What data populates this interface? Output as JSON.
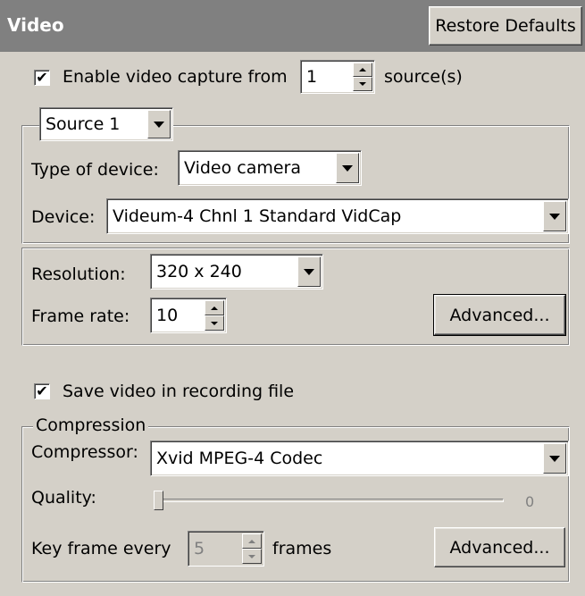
{
  "header": {
    "title": "Video",
    "restore_defaults_label": "Restore Defaults"
  },
  "capture": {
    "enabled": true,
    "check_mark": "✔",
    "label_prefix": "Enable video capture from",
    "source_count": "1",
    "label_suffix": "source(s)"
  },
  "source": {
    "selected": "Source 1",
    "type_label": "Type of device:",
    "type_value": "Video camera",
    "device_label": "Device:",
    "device_value": "Videum-4 Chnl 1 Standard VidCap"
  },
  "format": {
    "resolution_label": "Resolution:",
    "resolution_value": "320 x 240",
    "frame_rate_label": "Frame rate:",
    "frame_rate_value": "10",
    "advanced_label": "Advanced..."
  },
  "save": {
    "enabled": true,
    "check_mark": "✔",
    "label": "Save video in recording file"
  },
  "compression": {
    "group_label": "Compression",
    "compressor_label": "Compressor:",
    "compressor_value": "Xvid MPEG-4 Codec",
    "quality_label": "Quality:",
    "quality_value": "0",
    "quality_fraction": 0,
    "keyframe_label": "Key frame every",
    "keyframe_value": "5",
    "keyframe_suffix": "frames",
    "advanced_label": "Advanced..."
  }
}
